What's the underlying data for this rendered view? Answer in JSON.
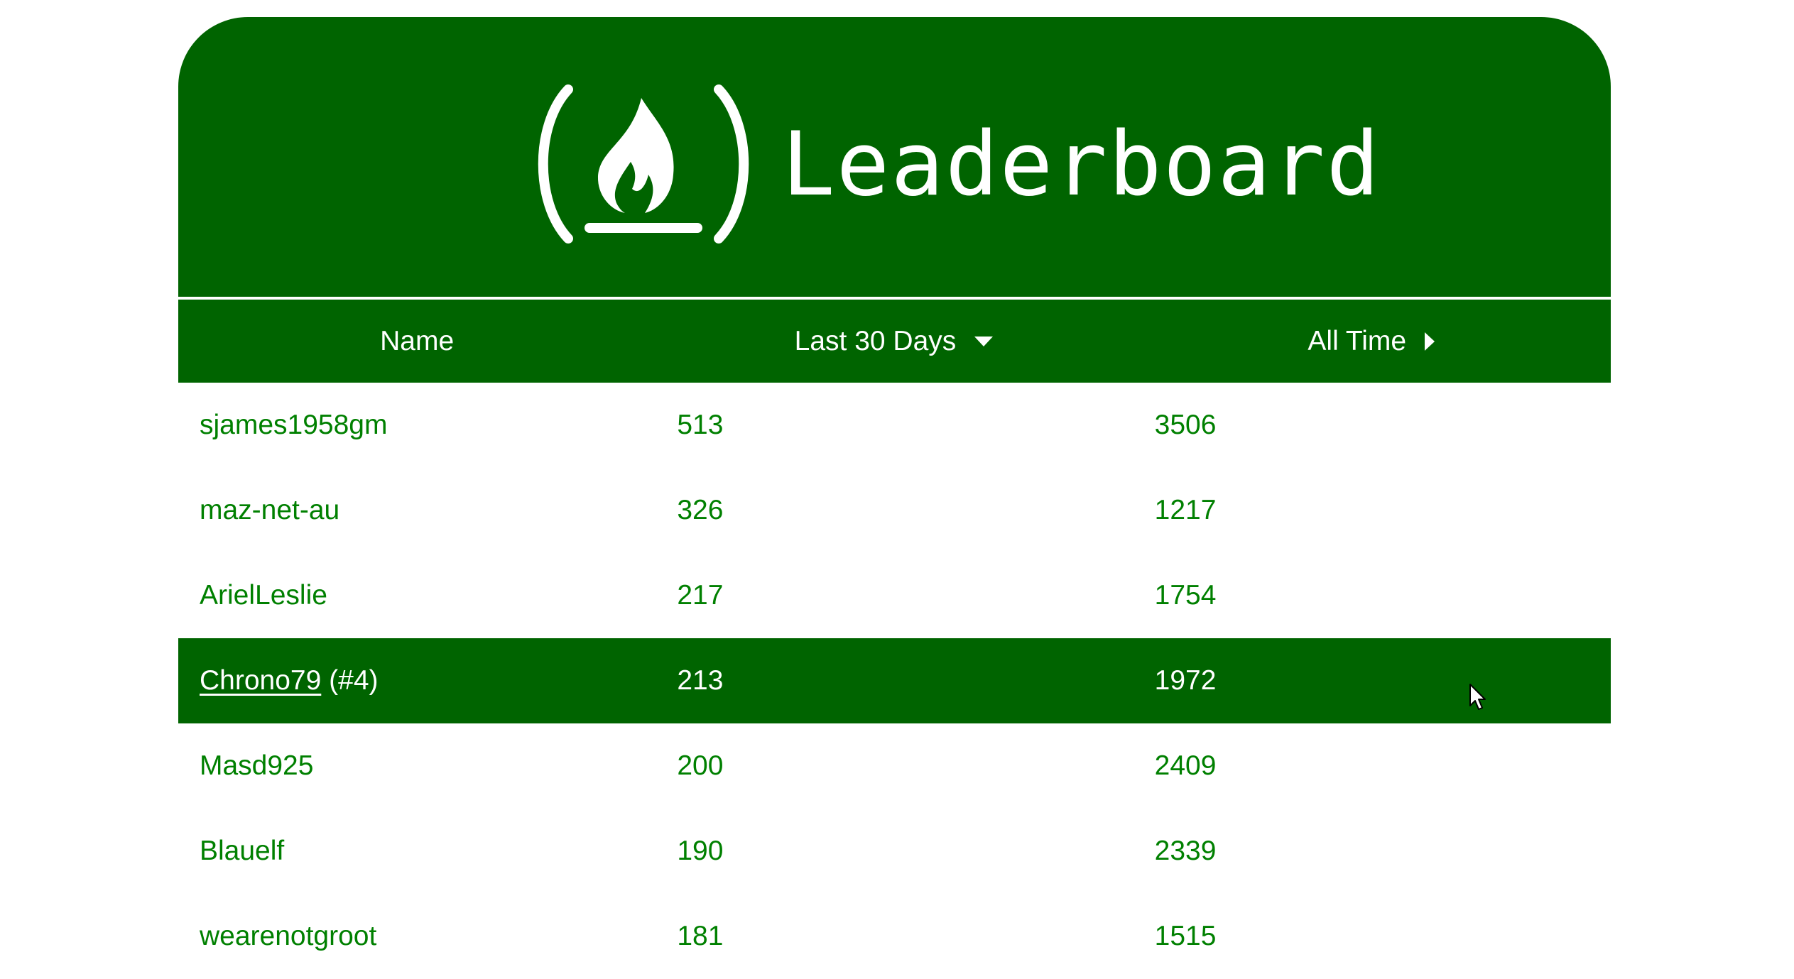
{
  "header": {
    "title": "Leaderboard",
    "logo_icon": "freecodecamp-flame-logo-icon",
    "background_color": "#006400"
  },
  "columns": [
    {
      "label": "Name",
      "icon": ""
    },
    {
      "label": "Last 30 Days",
      "icon": "caret-down-icon"
    },
    {
      "label": "All Time",
      "icon": "caret-right-icon"
    }
  ],
  "rows": [
    {
      "name": "sjames1958gm",
      "rank_suffix": "",
      "recent": "513",
      "alltime": "3506",
      "highlighted": false
    },
    {
      "name": "maz-net-au",
      "rank_suffix": "",
      "recent": "326",
      "alltime": "1217",
      "highlighted": false
    },
    {
      "name": "ArielLeslie",
      "rank_suffix": "",
      "recent": "217",
      "alltime": "1754",
      "highlighted": false
    },
    {
      "name": "Chrono79",
      "rank_suffix": "(#4)",
      "recent": "213",
      "alltime": "1972",
      "highlighted": true
    },
    {
      "name": "Masd925",
      "rank_suffix": "",
      "recent": "200",
      "alltime": "2409",
      "highlighted": false
    },
    {
      "name": "Blauelf",
      "rank_suffix": "",
      "recent": "190",
      "alltime": "2339",
      "highlighted": false
    },
    {
      "name": "wearenotgroot",
      "rank_suffix": "",
      "recent": "181",
      "alltime": "1515",
      "highlighted": false
    }
  ],
  "colors": {
    "text_green": "#008000",
    "highlight_row": "#006400"
  }
}
